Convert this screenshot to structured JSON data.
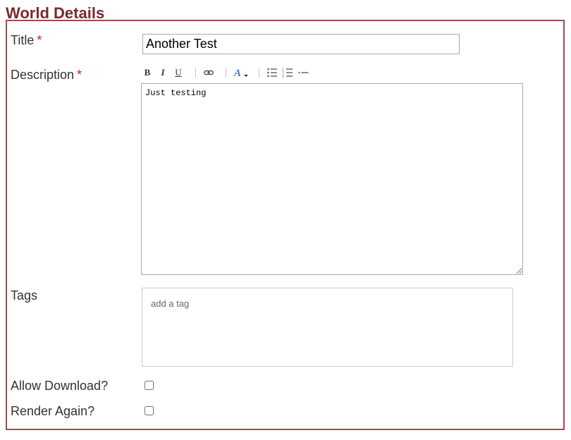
{
  "page": {
    "heading": "World Details"
  },
  "form": {
    "title": {
      "label": "Title",
      "required_marker": "*",
      "value": "Another Test"
    },
    "description": {
      "label": "Description",
      "required_marker": "*",
      "value": "Just testing",
      "toolbar": {
        "bold": "B",
        "italic": "I",
        "underline": "U",
        "tools": [
          "bold",
          "italic",
          "underline",
          "link-icon",
          "font-color-icon",
          "bulleted-list-icon",
          "numbered-list-icon",
          "horizontal-rule-icon"
        ]
      }
    },
    "tags": {
      "label": "Tags",
      "placeholder": "add a tag"
    },
    "allow_download": {
      "label": "Allow Download?",
      "checked": false
    },
    "render_again": {
      "label": "Render Again?",
      "checked": false
    }
  },
  "colors": {
    "heading": "#7a2a2a",
    "panel_border": "#a44a4e",
    "required_marker": "#cc2222",
    "font_color_icon": "#4a7ab8"
  }
}
